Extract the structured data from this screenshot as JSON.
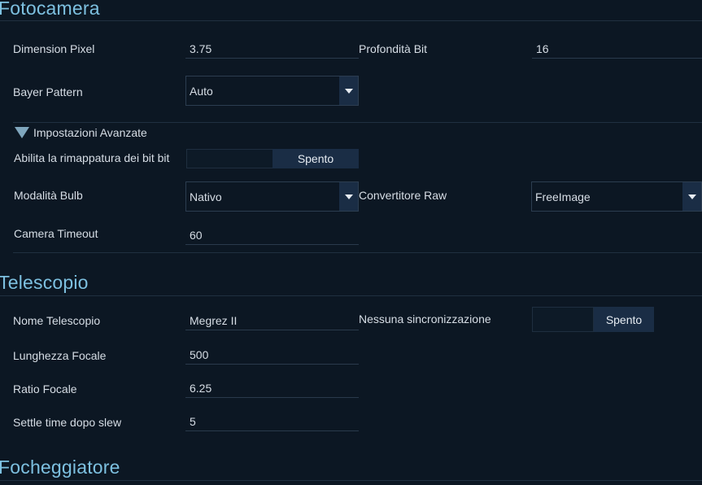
{
  "camera": {
    "title": "Fotocamera",
    "pixel_size_label": "Dimension Pixel",
    "pixel_size_value": "3.75",
    "bit_depth_label": "Profondità Bit",
    "bit_depth_value": "16",
    "bayer_label": "Bayer Pattern",
    "bayer_value": "Auto",
    "advanced_label": "Impostazioni Avanzate",
    "bitscale_label": "Abilita la rimappatura dei bit bit",
    "bitscale_value": "Spento",
    "bulb_label": "Modalità Bulb",
    "bulb_value": "Nativo",
    "raw_label": "Convertitore Raw",
    "raw_value": "FreeImage",
    "timeout_label": "Camera Timeout",
    "timeout_value": "60"
  },
  "telescope": {
    "title": "Telescopio",
    "name_label": "Nome Telescopio",
    "name_value": "Megrez II",
    "nosync_label": "Nessuna sincronizzazione",
    "nosync_value": "Spento",
    "focal_length_label": "Lunghezza Focale",
    "focal_length_value": "500",
    "focal_ratio_label": "Ratio Focale",
    "focal_ratio_value": "6.25",
    "settle_label": "Settle time dopo slew",
    "settle_value": "5"
  },
  "focuser": {
    "title": "Focheggiatore"
  },
  "colors": {
    "background": "#0c1723",
    "accent_title": "#7dc0e0",
    "button": "#1a2d45"
  }
}
